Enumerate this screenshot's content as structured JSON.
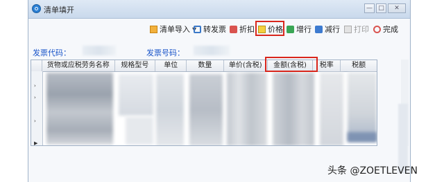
{
  "window": {
    "title": "清单填开"
  },
  "window_buttons": {
    "minimize": "—",
    "maximize": "□",
    "close": "✕"
  },
  "toolbar": {
    "list_import": "清单导入",
    "convert_invoice": "转发票",
    "discount": "折扣",
    "price": "价格",
    "add_row": "增行",
    "delete_row": "减行",
    "print": "打印",
    "finish": "完成"
  },
  "fields": {
    "invoice_code_label": "发票代码：",
    "invoice_number_label": "发票号码："
  },
  "table": {
    "columns": [
      "货物或应税劳务名称",
      "规格型号",
      "单位",
      "数量",
      "单价(含税)",
      "金额(含税)",
      "税率",
      "税额"
    ]
  },
  "watermark": "头条 @ZOETLEVEN"
}
